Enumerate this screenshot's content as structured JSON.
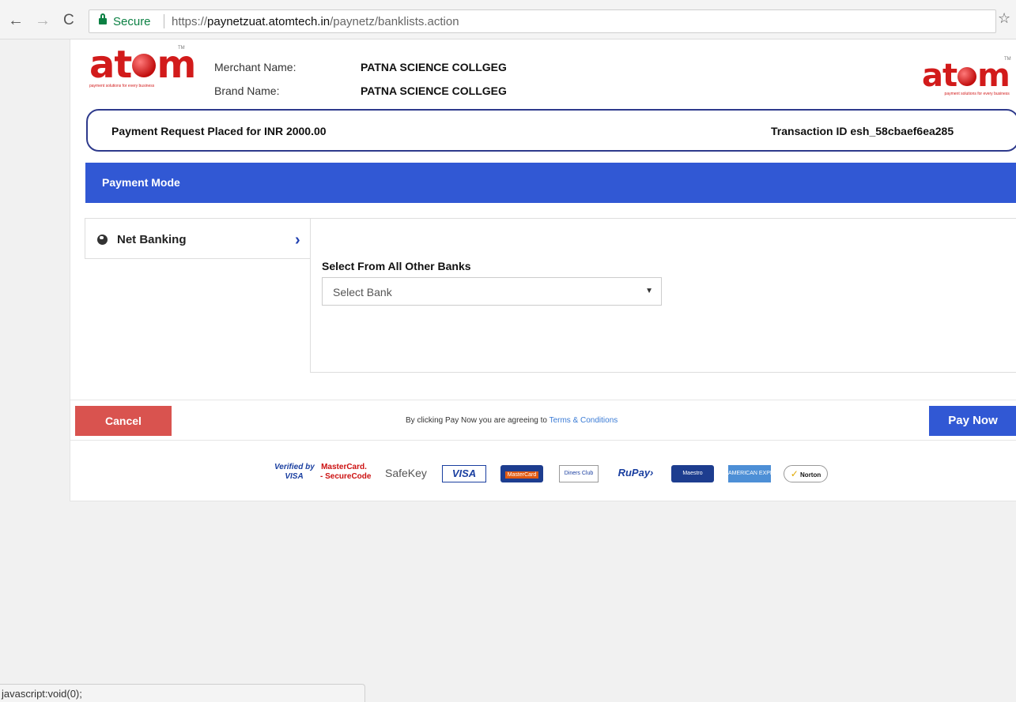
{
  "browser": {
    "back_icon": "←",
    "forward_icon": "→",
    "reload_icon": "C",
    "secure_label": "Secure",
    "url_scheme": "https://",
    "url_host": "paynetzuat.atomtech.in",
    "url_path": "/paynetz/banklists.action",
    "star_icon": "☆"
  },
  "logo": {
    "left_before": "at",
    "left_after": "m",
    "left_tagline": "payment solutions for every business",
    "tm": "TM",
    "right_before": "at",
    "right_after": "m",
    "right_tagline": "payment solutions for every business"
  },
  "merchant": {
    "merchant_label": "Merchant Name:",
    "merchant_value": "PATNA SCIENCE COLLGEG",
    "brand_label": "Brand Name:",
    "brand_value": "PATNA SCIENCE COLLGEG"
  },
  "request": {
    "text": "Payment Request Placed for INR  2000.00",
    "transaction": "Transaction ID  esh_58cbaef6ea285"
  },
  "payment_mode": {
    "title": "Payment Mode",
    "tab_label": "Net Banking",
    "chevron": "›"
  },
  "banks": {
    "label": "Select From All Other Banks",
    "select_value": "Select Bank",
    "arrow": "▼"
  },
  "actions": {
    "cancel_label": "Cancel",
    "agree_text": "By clicking Pay Now you are agreeing to ",
    "terms_link": "Terms & Conditions",
    "pay_label": "Pay Now"
  },
  "badges": {
    "vbv_line1": "Verified by",
    "vbv_line2": "VISA",
    "mcsc_line1": "MasterCard.",
    "mcsc_line2": "- SecureCode",
    "safekey": "SafeKey",
    "visa": "VISA",
    "mastercard": "MasterCard",
    "diners": "Diners Club",
    "rupay": "RuPay›",
    "maestro": "Maestro",
    "amex": "AMERICAN EXPRESS",
    "norton": "Norton",
    "norton_tick": "✓"
  },
  "status_bar": {
    "text": "javascript:void(0);"
  },
  "colors": {
    "primary_blue": "#3158d4",
    "cancel_red": "#d9534f",
    "logo_red": "#d21b1b",
    "secure_green": "#0b8043"
  }
}
